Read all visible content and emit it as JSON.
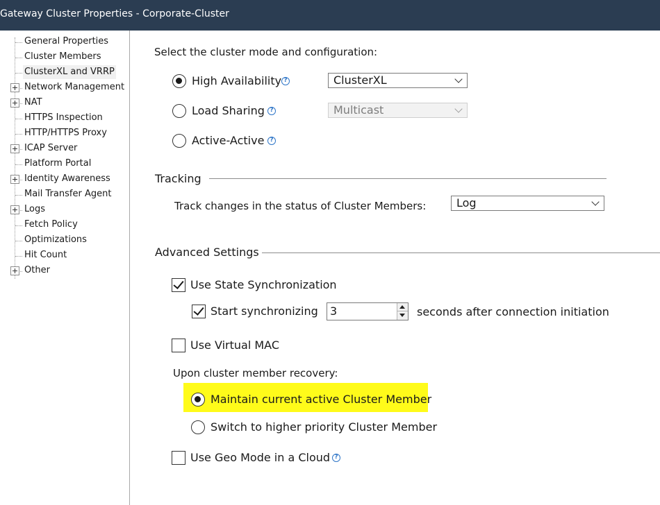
{
  "window": {
    "title": "Gateway Cluster Properties - Corporate-Cluster"
  },
  "colors": {
    "titlebar": "#2b3d52",
    "highlight": "#fffb1a",
    "help_icon": "#2f76c8"
  },
  "tree": {
    "items": [
      {
        "label": "General Properties",
        "expandable": false,
        "selected": false
      },
      {
        "label": "Cluster Members",
        "expandable": false,
        "selected": false
      },
      {
        "label": "ClusterXL and VRRP",
        "expandable": false,
        "selected": true
      },
      {
        "label": "Network Management",
        "expandable": true,
        "selected": false
      },
      {
        "label": "NAT",
        "expandable": true,
        "selected": false
      },
      {
        "label": "HTTPS Inspection",
        "expandable": false,
        "selected": false
      },
      {
        "label": "HTTP/HTTPS Proxy",
        "expandable": false,
        "selected": false
      },
      {
        "label": "ICAP Server",
        "expandable": true,
        "selected": false
      },
      {
        "label": "Platform Portal",
        "expandable": false,
        "selected": false
      },
      {
        "label": "Identity Awareness",
        "expandable": true,
        "selected": false
      },
      {
        "label": "Mail Transfer Agent",
        "expandable": false,
        "selected": false
      },
      {
        "label": "Logs",
        "expandable": true,
        "selected": false
      },
      {
        "label": "Fetch Policy",
        "expandable": false,
        "selected": false
      },
      {
        "label": "Optimizations",
        "expandable": false,
        "selected": false
      },
      {
        "label": "Hit Count",
        "expandable": false,
        "selected": false
      },
      {
        "label": "Other",
        "expandable": true,
        "selected": false
      }
    ]
  },
  "mode": {
    "heading": "Select the cluster mode and configuration:",
    "high_availability": {
      "label": "High Availability",
      "checked": true,
      "select_value": "ClusterXL"
    },
    "load_sharing": {
      "label": "Load Sharing",
      "checked": false,
      "select_value": "Multicast"
    },
    "active_active": {
      "label": "Active-Active",
      "checked": false
    }
  },
  "tracking": {
    "heading": "Tracking",
    "label": "Track changes in the status of Cluster Members:",
    "select_value": "Log"
  },
  "advanced": {
    "heading": "Advanced Settings",
    "state_sync": {
      "label": "Use State Synchronization",
      "checked": true
    },
    "start_sync": {
      "label": "Start synchronizing",
      "checked": true,
      "value": "3",
      "suffix": "seconds after connection initiation"
    },
    "virtual_mac": {
      "label": "Use Virtual MAC",
      "checked": false
    },
    "recovery": {
      "label": "Upon cluster member recovery:",
      "maintain": {
        "label": "Maintain current active Cluster Member",
        "checked": true
      },
      "switch": {
        "label": "Switch to higher priority Cluster Member",
        "checked": false
      }
    },
    "geo_mode": {
      "label": "Use Geo Mode in a Cloud",
      "checked": false
    }
  },
  "icons": {
    "help": "help-icon",
    "expander": "plus-icon"
  }
}
